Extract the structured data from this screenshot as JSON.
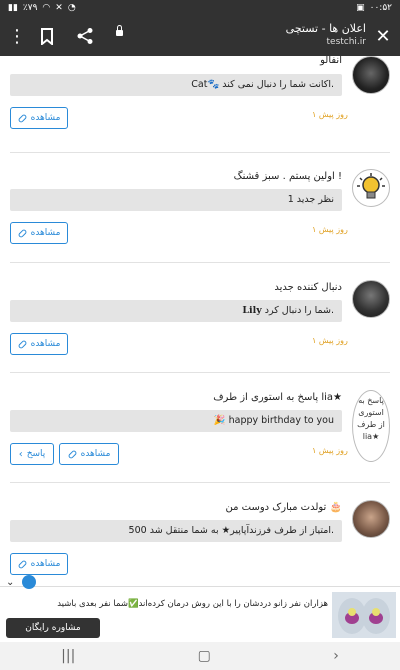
{
  "status": {
    "time": "۰۰:۵۲",
    "battery": "٪۷۹"
  },
  "browser": {
    "title": "اعلان ها - تستچی",
    "url": "testchi.ir"
  },
  "items": [
    {
      "headline": "آنفالو",
      "message": "Cat🐾 اکانت شما را دنبال نمی کند.",
      "time": "۱ روز پیش",
      "view_label": "مشاهده"
    },
    {
      "headline": "اولین پستم . سبز قشنگ !",
      "message": "1 نظر جدید",
      "time": "۱ روز پیش",
      "view_label": "مشاهده"
    },
    {
      "headline": "دنبال کننده جدید",
      "message_bold": "Lily",
      "message_rest": "شما را دنبال کرد.",
      "time": "۱ روز پیش",
      "view_label": "مشاهده"
    },
    {
      "headline": "پاسخ به استوری از طرف lia★",
      "avatar_alt": "پاسخ به استوری از طرف lia★",
      "message": "🎉 happy birthday to you",
      "time": "۱ روز پیش",
      "view_label": "مشاهده",
      "reply_label": "پاسخ"
    },
    {
      "headline": "تولدت مبارک دوست من 🎂",
      "message": "500 امتیاز از طرف فرزندآپاپیر★ به شما منتقل شد.",
      "time": "۱ روز پیش",
      "view_label": "مشاهده"
    }
  ],
  "ad": {
    "text": "هزاران نفر زانو دردشان را با این روش درمان کرده‌اند✅شما نفر بعدی باشید",
    "button": "مشاوره رایگان"
  },
  "colors": {
    "accent": "#2a8ad8",
    "time": "#e0a020",
    "topbar": "#323232"
  }
}
